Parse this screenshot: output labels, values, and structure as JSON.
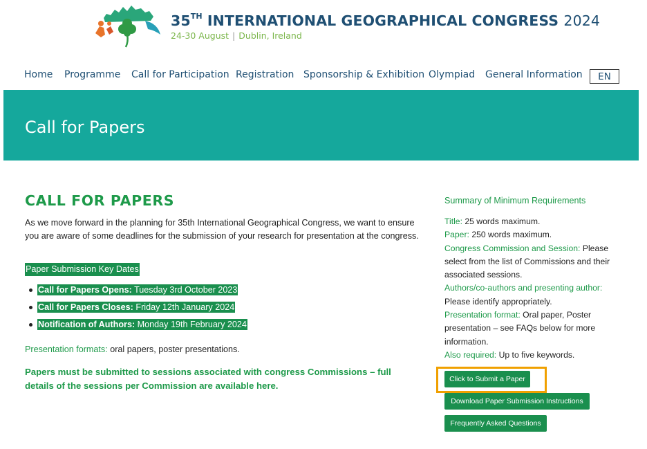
{
  "header": {
    "title_number": "35",
    "title_suffix": "TH",
    "title_main": "INTERNATIONAL GEOGRAPHICAL CONGRESS",
    "title_year": "2024",
    "dates": "24-30 August",
    "separator": "|",
    "location": "Dublin, Ireland"
  },
  "nav": {
    "items": [
      {
        "label": "Home"
      },
      {
        "label": "Programme"
      },
      {
        "label": "Call for Participation"
      },
      {
        "label": "Registration"
      },
      {
        "label": "Sponsorship & Exhibition"
      },
      {
        "label": "Olympiad"
      },
      {
        "label": "General Information"
      }
    ],
    "language": "EN"
  },
  "banner": {
    "title": "Call for Papers"
  },
  "main": {
    "heading": "CALL FOR PAPERS",
    "intro": "As we move forward in the planning for 35th International Geographical Congress, we want to ensure you are aware of some deadlines for the submission of your research for presentation at the congress.",
    "key_dates_title": "Paper Submission Key Dates",
    "key_dates": [
      {
        "label": "Call for Papers Opens:",
        "value": "Tuesday 3rd October 2023"
      },
      {
        "label": "Call for Papers Closes:",
        "value": "Friday 12th January 2024"
      },
      {
        "label": "Notification of Authors:",
        "value": "Monday 19th February 2024"
      }
    ],
    "formats_label": "Presentation formats:",
    "formats_value": "oral papers, poster presentations.",
    "commission_note": "Papers must be submitted to sessions associated with congress Commissions – full details of the sessions per Commission are available here."
  },
  "sidebar": {
    "title": "Summary of Minimum Requirements",
    "requirements": [
      {
        "label": "Title:",
        "value": "25 words maximum."
      },
      {
        "label": "Paper:",
        "value": "250 words maximum."
      },
      {
        "label": "Congress Commission and Session:",
        "value": "Please select from the list of Commissions and their associated sessions."
      },
      {
        "label": "Authors/co-authors and presenting author:",
        "value": "Please identify appropriately."
      },
      {
        "label": "Presentation format:",
        "value": "Oral paper, Poster presentation – see FAQs below for more information."
      },
      {
        "label": "Also required:",
        "value": "Up to five keywords."
      }
    ],
    "buttons": {
      "submit": "Click to Submit a Paper",
      "download": "Download Paper Submission Instructions",
      "faq": "Frequently Asked Questions"
    }
  },
  "colors": {
    "brand_navy": "#1f4f73",
    "banner_teal": "#15a89c",
    "accent_green": "#1e9a4a",
    "highlight_orange": "#f0a000"
  }
}
